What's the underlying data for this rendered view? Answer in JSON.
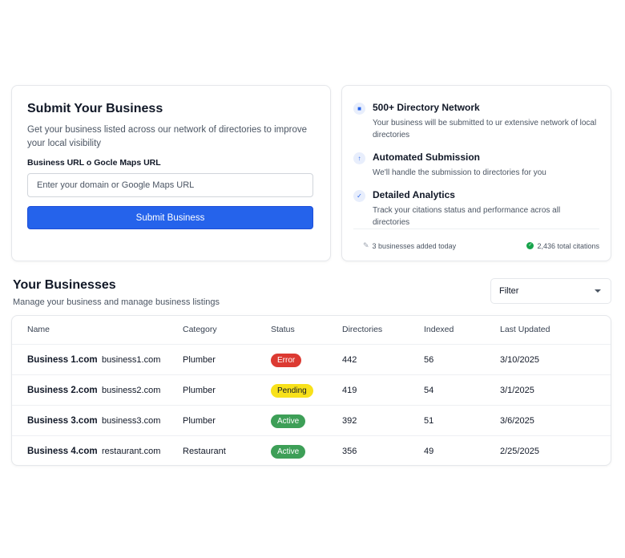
{
  "submit": {
    "title": "Submit Your Business",
    "description": "Get your business listed across our network of directories to improve your local visibility",
    "field_label": "Business URL o Gocle Maps URL",
    "input_placeholder": "Enter your domain or Google Maps URL",
    "input_value": "",
    "button_label": "Submit Business"
  },
  "features": {
    "items": [
      {
        "icon": "lock-icon",
        "title": "500+ Directory Network",
        "description": "Your business will be submitted to ur extensive network of local directories"
      },
      {
        "icon": "arrow-up-icon",
        "title": "Automated Submission",
        "description": "We'll handle the submission to directories for you"
      },
      {
        "icon": "check-icon",
        "title": "Detailed Analytics",
        "description": "Track your citations status and performance acros all directories"
      }
    ],
    "stats": {
      "added_today": "3 businesses added today",
      "total_citations": "2,436 total citations"
    }
  },
  "businesses": {
    "title": "Your Businesses",
    "subtitle": "Manage your business and manage business listings",
    "filter": {
      "selected": "Filter"
    },
    "columns": {
      "name": "Name",
      "category": "Category",
      "status": "Status",
      "directories": "Directories",
      "indexed": "Indexed",
      "last_updated": "Last Updated"
    },
    "rows": [
      {
        "name": "Business 1.com",
        "domain": "business1.com",
        "category": "Plumber",
        "status": "Error",
        "directories": "442",
        "indexed": "56",
        "last_updated": "3/10/2025"
      },
      {
        "name": "Business 2.com",
        "domain": "business2.com",
        "category": "Plumber",
        "status": "Pending",
        "directories": "419",
        "indexed": "54",
        "last_updated": "3/1/2025"
      },
      {
        "name": "Business 3.com",
        "domain": "business3.com",
        "category": "Plumber",
        "status": "Active",
        "directories": "392",
        "indexed": "51",
        "last_updated": "3/6/2025"
      },
      {
        "name": "Business 4.com",
        "domain": "restaurant.com",
        "category": "Restaurant",
        "status": "Active",
        "directories": "356",
        "indexed": "49",
        "last_updated": "2/25/2025"
      }
    ]
  },
  "colors": {
    "primary": "#2563eb",
    "error": "#dc3a32",
    "pending": "#f8e11a",
    "active": "#3d9f57"
  }
}
